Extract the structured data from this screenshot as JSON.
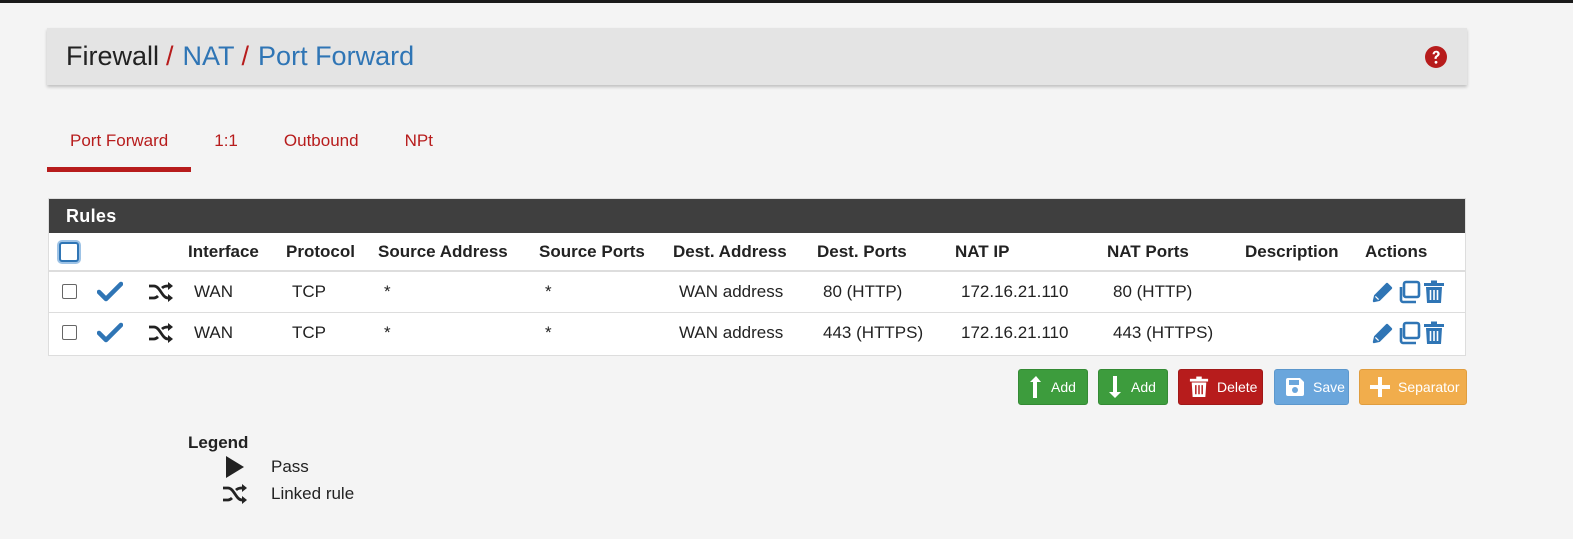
{
  "breadcrumb": {
    "root": "Firewall",
    "sep": "/",
    "level2": "NAT",
    "level3": "Port Forward"
  },
  "tabs": [
    {
      "label": "Port Forward",
      "active": true
    },
    {
      "label": "1:1",
      "active": false
    },
    {
      "label": "Outbound",
      "active": false
    },
    {
      "label": "NPt",
      "active": false
    }
  ],
  "rules": {
    "title": "Rules",
    "headers": {
      "interface": "Interface",
      "protocol": "Protocol",
      "source_address": "Source Address",
      "source_ports": "Source Ports",
      "dest_address": "Dest. Address",
      "dest_ports": "Dest. Ports",
      "nat_ip": "NAT IP",
      "nat_ports": "NAT Ports",
      "description": "Description",
      "actions": "Actions"
    },
    "rows": [
      {
        "interface": "WAN",
        "protocol": "TCP",
        "source_address": "*",
        "source_ports": "*",
        "dest_address": "WAN address",
        "dest_ports": "80 (HTTP)",
        "nat_ip": "172.16.21.110",
        "nat_ports": "80 (HTTP)",
        "description": ""
      },
      {
        "interface": "WAN",
        "protocol": "TCP",
        "source_address": "*",
        "source_ports": "*",
        "dest_address": "WAN address",
        "dest_ports": "443 (HTTPS)",
        "nat_ip": "172.16.21.110",
        "nat_ports": "443 (HTTPS)",
        "description": ""
      }
    ]
  },
  "buttons": {
    "add_top": "Add",
    "add_bottom": "Add",
    "delete": "Delete",
    "save": "Save",
    "separator": "Separator"
  },
  "legend": {
    "title": "Legend",
    "pass": "Pass",
    "linked": "Linked rule"
  },
  "colors": {
    "accent_red": "#b71c1c",
    "link_blue": "#2f75b5",
    "header_dark": "#3f3f3f",
    "success_green": "#3d9c3d",
    "save_blue": "#6aa6dc",
    "separator_orange": "#f1ad4c"
  }
}
